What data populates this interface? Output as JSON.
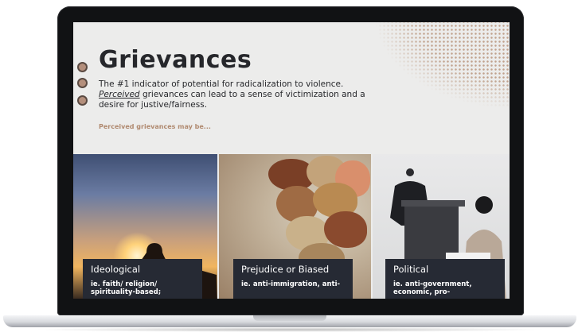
{
  "slide": {
    "title": "Grievances",
    "intro_line1": "The #1 indicator of potential for radicalization to violence.",
    "intro_em": "Perceived",
    "intro_rest": " grievances can lead to a sense of victimization and a desire for justive/fairness.",
    "lead": "Perceived grievances may be..."
  },
  "cards": [
    {
      "title": "Ideological",
      "subtitle": "ie. faith/ religion/ spirituality-based;"
    },
    {
      "title": "Prejudice or Biased",
      "subtitle": "ie. anti-immigration, anti-"
    },
    {
      "title": "Political",
      "subtitle": "ie. anti-government, economic, pro-"
    }
  ],
  "colors": {
    "accent": "#b08a70",
    "card_bg": "#262a34",
    "slide_bg": "#ececeb",
    "title": "#26272b"
  },
  "icons": {
    "bullet_dots": "circle-bullet-icon"
  }
}
